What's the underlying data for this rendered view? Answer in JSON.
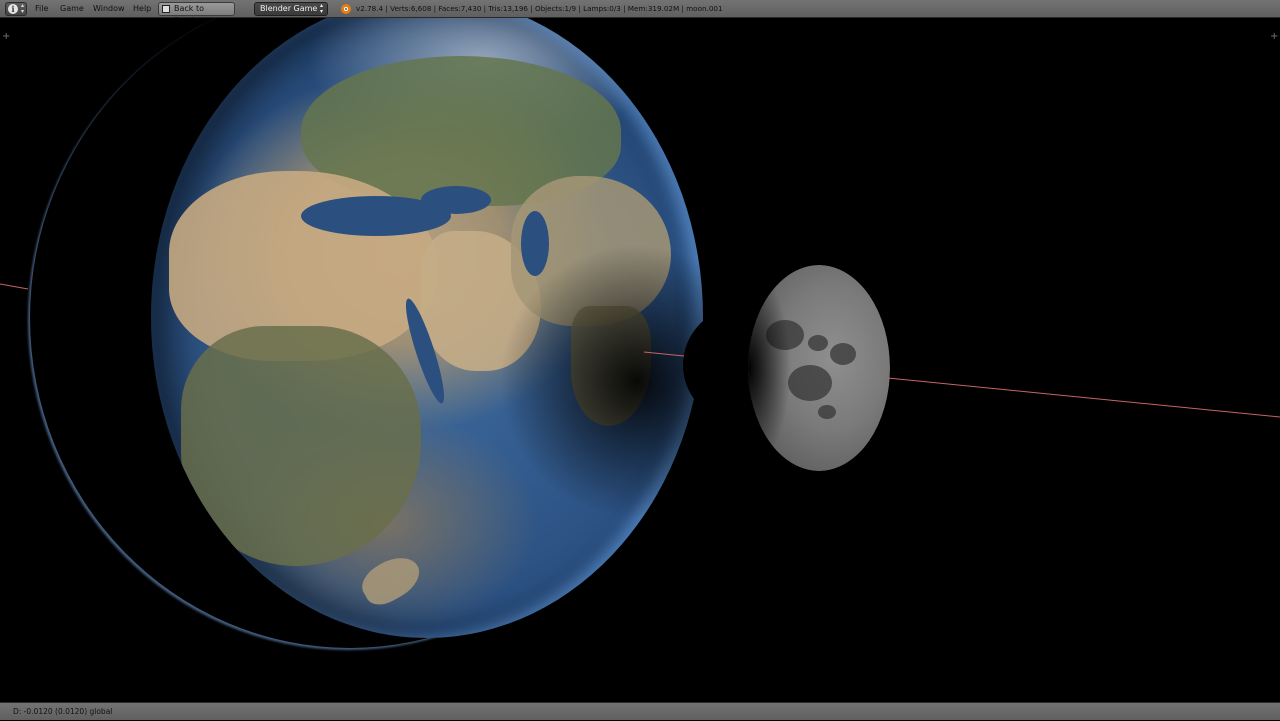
{
  "header": {
    "editor_icon": "info-icon",
    "menus": [
      "File",
      "Game",
      "Window",
      "Help"
    ],
    "back_button": "Back to Previous",
    "engine_select": "Blender Game",
    "stats": "v2.78.4 | Verts:6,608 | Faces:7,430 | Tris:13,196 | Objects:1/9 | Lamps:0/3 | Mem:319.02M | moon.001"
  },
  "viewport": {
    "objects": [
      "earth",
      "moon"
    ],
    "orbit_line_color": "#c86464"
  },
  "footer": {
    "status": "D: -0.0120 (0.0120) global"
  },
  "colors": {
    "header_bg": "#6a6a6a",
    "viewport_bg": "#000000",
    "blender_logo": "#e87d0d"
  }
}
